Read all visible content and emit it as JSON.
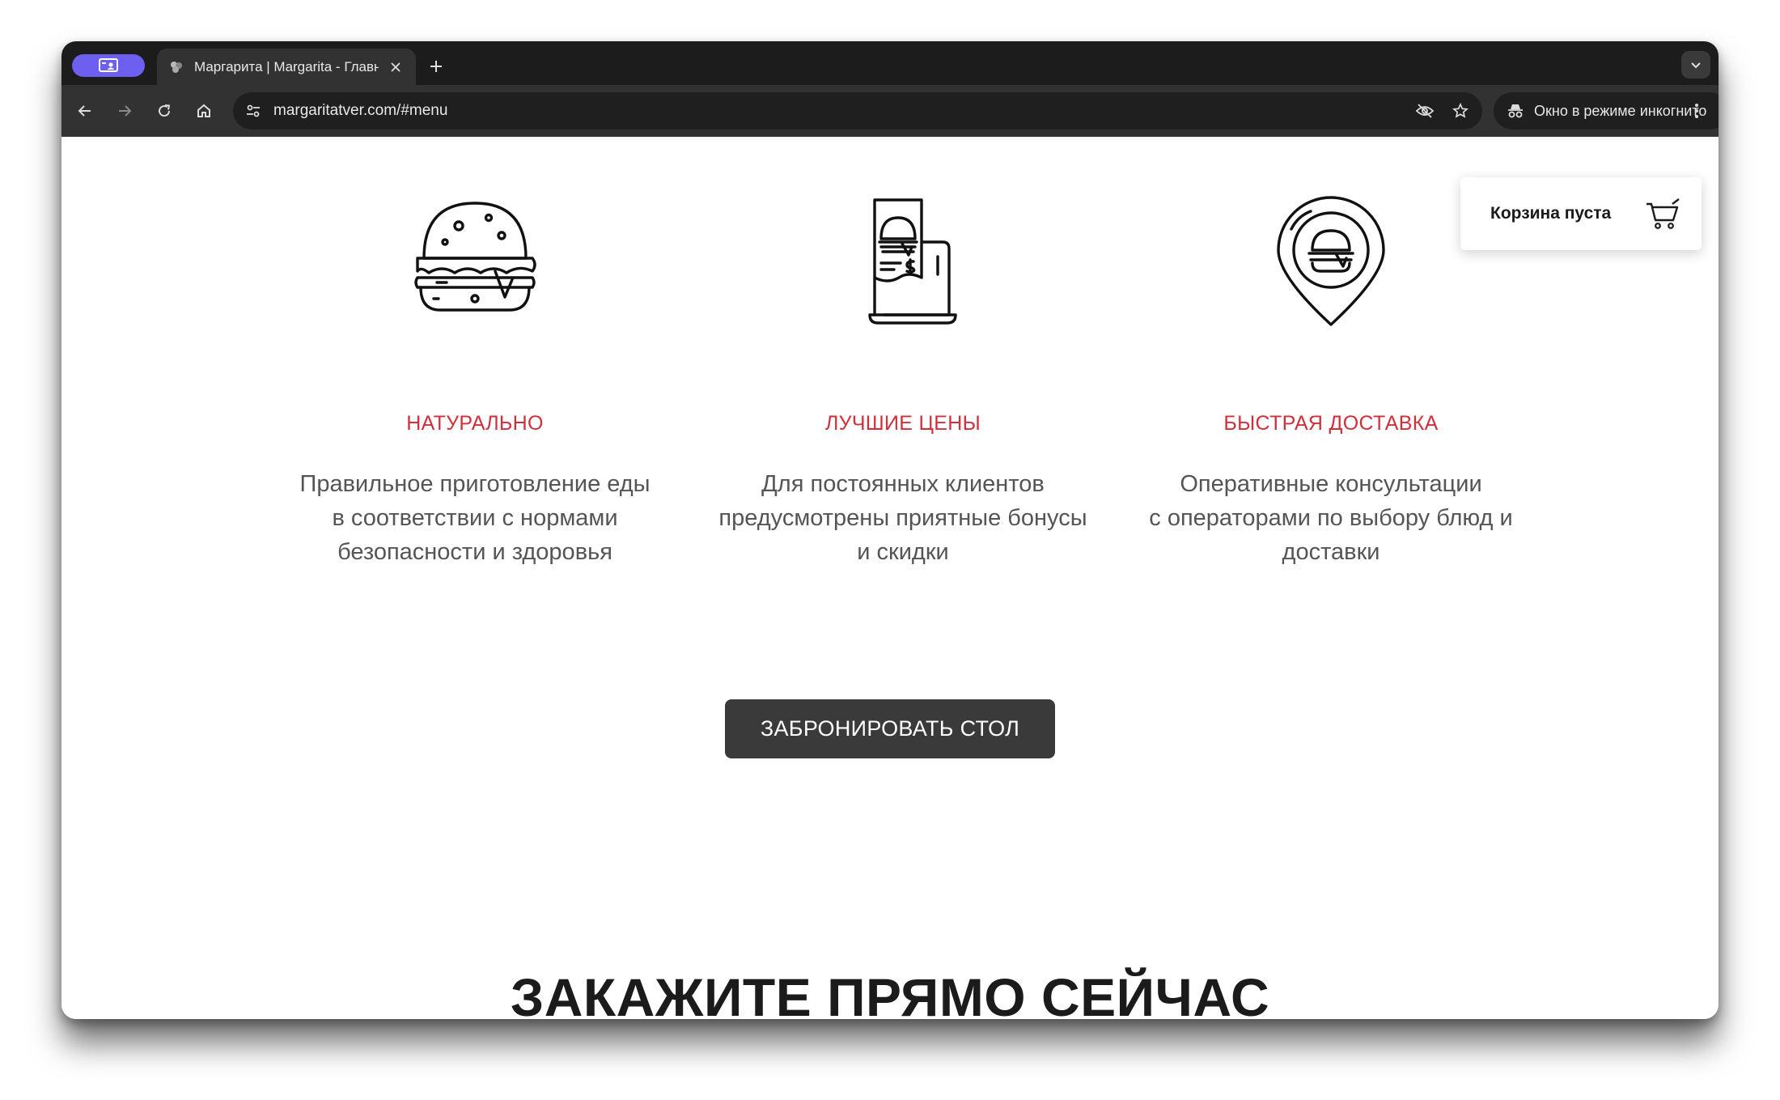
{
  "browser": {
    "tab": {
      "title": "Маргарита | Margarita - Главная"
    },
    "url": "margaritatver.com/#menu",
    "incognito_label": "Окно в режиме инкогнито"
  },
  "cart": {
    "label": "Корзина пуста"
  },
  "features": [
    {
      "title": "НАТУРАЛЬНО",
      "desc_lines": [
        "Правильное приготовление еды",
        "в соответствии с нормами",
        "безопасности и здоровья"
      ]
    },
    {
      "title": "ЛУЧШИЕ ЦЕНЫ",
      "desc_lines": [
        "Для постоянных клиентов",
        "предусмотрены приятные бонусы",
        "и скидки"
      ]
    },
    {
      "title": "БЫСТРАЯ ДОСТАВКА",
      "desc_lines": [
        "Оперативные консультации",
        "с операторами по выбору блюд и",
        "доставки"
      ]
    }
  ],
  "book_button": {
    "label": "ЗАБРОНИРОВАТЬ СТОЛ"
  },
  "order_heading": "ЗАКАЖИТЕ ПРЯМО СЕЙЧАС",
  "icons": {
    "feature_1": "burger-icon",
    "feature_2": "receipt-laptop-icon",
    "feature_3": "location-pin-burger-icon",
    "cart": "shopping-cart-icon"
  },
  "colors": {
    "accent_red": "#d32f3a",
    "button_dark": "#3a3a3a",
    "profile_purple": "#6d5ff0"
  }
}
